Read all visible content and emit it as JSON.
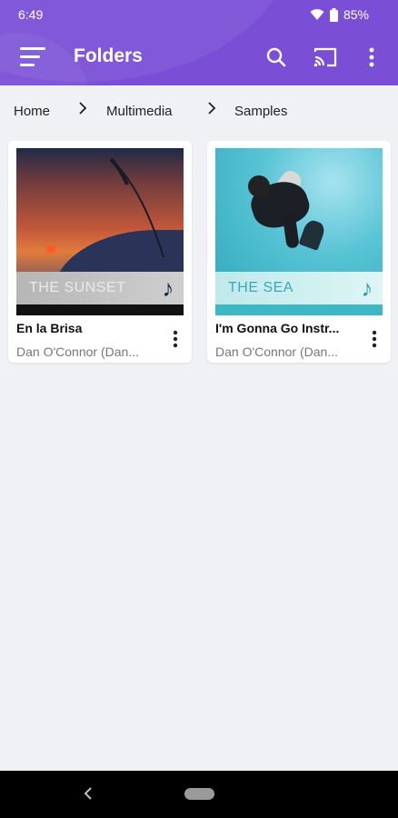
{
  "status_bar": {
    "time": "6:49",
    "battery": "85%"
  },
  "app_bar": {
    "title": "Folders"
  },
  "breadcrumb": [
    "Home",
    "Multimedia",
    "Samples"
  ],
  "items": [
    {
      "title": "En la Brisa",
      "subtitle": "Dan O'Connor (Dan...",
      "artwork_caption": "THE SUNSET"
    },
    {
      "title": "I'm Gonna Go Instr...",
      "subtitle": "Dan O'Connor (Dan...",
      "artwork_caption": "THE SEA"
    }
  ],
  "icons": {
    "menu": "menu-icon",
    "search": "search-icon",
    "cast": "cast-icon",
    "more": "more-vert-icon",
    "wifi": "wifi-icon",
    "battery": "battery-icon",
    "chevron": "chevron-right-icon",
    "back": "back-icon",
    "home": "home-pill-icon"
  },
  "colors": {
    "accent": "#7a4fd6",
    "background": "#f0f1f5"
  }
}
